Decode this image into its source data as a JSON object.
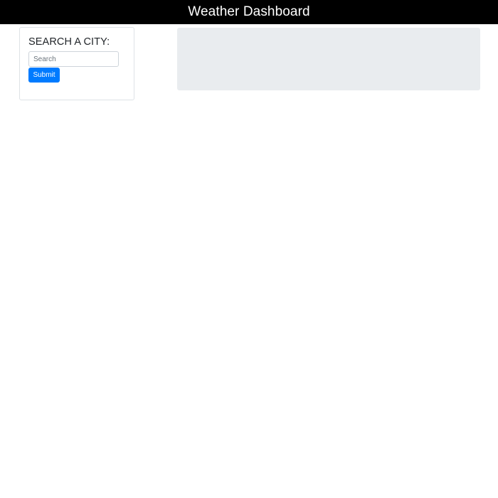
{
  "header": {
    "title": "Weather Dashboard"
  },
  "search": {
    "heading": "SEARCH A CITY:",
    "placeholder": "Search",
    "value": "",
    "submit_label": "Submit"
  },
  "weather_panel": {
    "content": ""
  },
  "colors": {
    "header_bg": "#000000",
    "header_text": "#ffffff",
    "button_bg": "#007bff",
    "panel_bg": "#e9ecef"
  }
}
